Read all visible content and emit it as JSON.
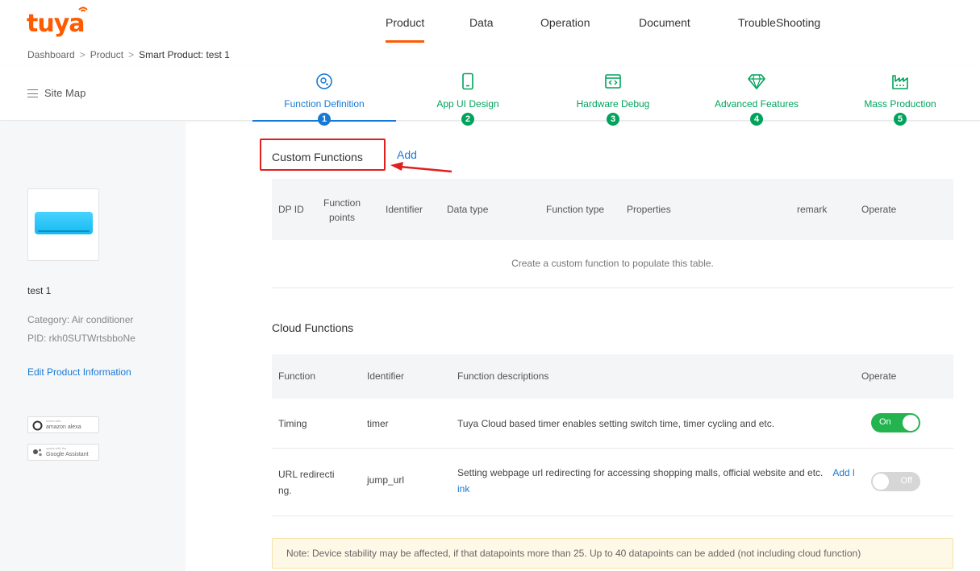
{
  "brand": {
    "logo_text": "tuya"
  },
  "nav": {
    "items": [
      "Product",
      "Data",
      "Operation",
      "Document",
      "TroubleShooting"
    ],
    "active": "Product"
  },
  "breadcrumb": {
    "items": [
      "Dashboard",
      "Product",
      "Smart Product: test 1"
    ],
    "separator": ">"
  },
  "sitemap": {
    "label": "Site Map"
  },
  "steps": [
    {
      "label": "Function Definition",
      "number": "1",
      "icon": "gear-icon",
      "active": true
    },
    {
      "label": "App UI Design",
      "number": "2",
      "icon": "phone-icon",
      "active": false
    },
    {
      "label": "Hardware Debug",
      "number": "3",
      "icon": "code-window-icon",
      "active": false
    },
    {
      "label": "Advanced Features",
      "number": "4",
      "icon": "diamond-icon",
      "active": false
    },
    {
      "label": "Mass Production",
      "number": "5",
      "icon": "factory-icon",
      "active": false
    }
  ],
  "product": {
    "name": "test 1",
    "category": "Category: Air conditioner",
    "pid": "PID: rkh0SUTWrtsbboNe",
    "edit_link": "Edit Product Information",
    "badges": [
      {
        "small": "works with",
        "text": "amazon alexa",
        "icon": "alexa-icon"
      },
      {
        "small": "works with the",
        "text": "Google Assistant",
        "icon": "google-assistant-icon"
      }
    ]
  },
  "custom_functions": {
    "title": "Custom Functions",
    "add_label": "Add",
    "columns": [
      "DP ID",
      "Function points",
      "Identifier",
      "Data type",
      "Function type",
      "Properties",
      "remark",
      "Operate"
    ],
    "empty_text": "Create a custom function to populate this table."
  },
  "cloud_functions": {
    "title": "Cloud Functions",
    "columns": [
      "Function",
      "Identifier",
      "Function descriptions",
      "Operate"
    ],
    "rows": [
      {
        "function": "Timing",
        "identifier": "timer",
        "description": "Tuya Cloud based timer enables setting switch time, timer cycling and etc.",
        "link": "",
        "toggle": "On",
        "state": true
      },
      {
        "function": "URL redirecting.",
        "identifier": "jump_url",
        "description": "Setting webpage url redirecting for accessing shopping malls, official website and etc.",
        "link": "Add link",
        "toggle": "Off",
        "state": false
      }
    ]
  },
  "note": {
    "text": "Note: Device stability may be affected, if that datapoints more than 25. Up to 40 datapoints can be added (not including cloud function)"
  },
  "colors": {
    "brand": "#ff5a00",
    "primary": "#1679d6",
    "success": "#00a35b",
    "highlight": "#e01f1f"
  }
}
